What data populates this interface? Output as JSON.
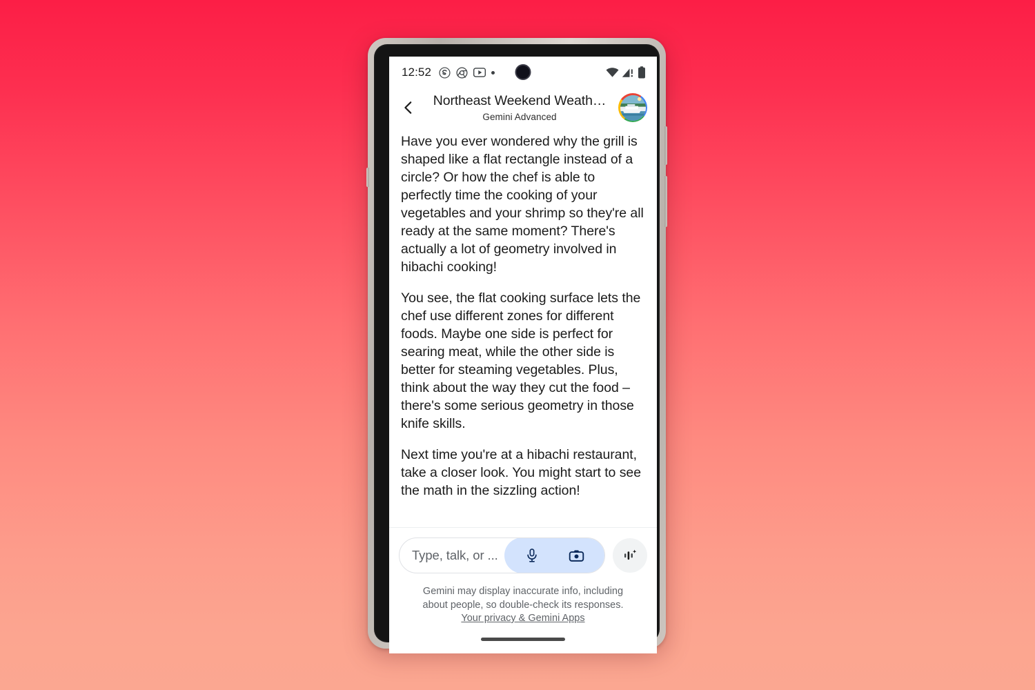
{
  "background": {
    "gradient_top": "#FC1E46",
    "gradient_bottom": "#FBA791"
  },
  "status_bar": {
    "clock": "12:52",
    "left_icons": [
      "skype-icon",
      "chrome-icon",
      "youtube-icon",
      "notification-dot-icon"
    ],
    "right_icons": [
      "wifi-icon",
      "cellular-no-service-icon",
      "battery-full-icon"
    ],
    "punch_hole": "front-camera-punch-hole"
  },
  "header": {
    "back_icon": "chevron-left-icon",
    "title": "Northeast Weekend Weath…",
    "subtitle": "Gemini Advanced",
    "avatar": "account-avatar-cruise-ship-photo",
    "avatar_ring_colors": [
      "#EA4335",
      "#4285F4",
      "#34A853",
      "#FBBC05"
    ]
  },
  "conversation": {
    "paragraphs": [
      "Have you ever wondered why the grill is shaped like a flat rectangle instead of a circle? Or how the chef is able to perfectly time the cooking of your vegetables and your shrimp so they're all ready at the same moment? There's actually a lot of geometry involved in hibachi cooking!",
      "You see, the flat cooking surface lets the chef use different zones for different foods. Maybe one side is perfect for searing meat, while the other side is better for steaming vegetables. Plus, think about the way they cut the food – there's some serious geometry in those knife skills.",
      "Next time you're at a hibachi restaurant, take a closer look. You might start to see the math in the sizzling action!"
    ]
  },
  "composer": {
    "placeholder": "Type, talk, or ...",
    "value": "",
    "mic_icon": "microphone-icon",
    "camera_icon": "camera-icon",
    "live_icon": "gemini-live-waveform-sparkle-icon",
    "capsule_color": "#D3E3FD",
    "capsule_icon_color": "#0B2A5B"
  },
  "footer": {
    "disclaimer_line_1": "Gemini may display inaccurate info, including",
    "disclaimer_line_2": "about people, so double-check its responses.",
    "privacy_link": "Your privacy & Gemini Apps"
  },
  "gesture_nav": {
    "home_pill": "home-gesture-pill"
  }
}
